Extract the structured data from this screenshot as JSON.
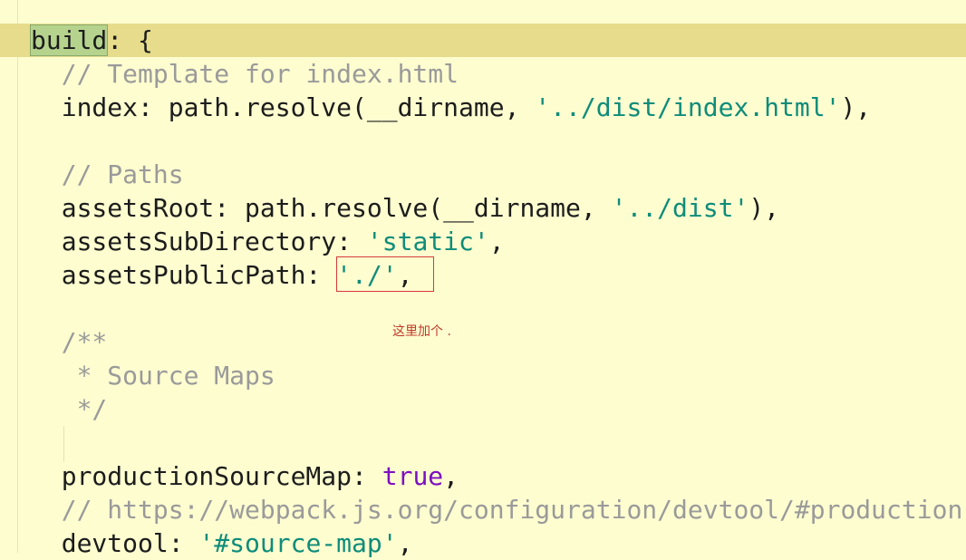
{
  "editor": {
    "lines": [
      {
        "parts": [
          {
            "t": "build",
            "c": "sel"
          },
          {
            "t": ": {",
            "c": "plain"
          }
        ]
      },
      {
        "parts": [
          {
            "t": "  // Template for index.html",
            "c": "cm"
          }
        ]
      },
      {
        "parts": [
          {
            "t": "  index: path.resolve(__dirname, ",
            "c": "plain"
          },
          {
            "t": "'../dist/index.html'",
            "c": "str"
          },
          {
            "t": "),",
            "c": "plain"
          }
        ]
      },
      {
        "parts": []
      },
      {
        "parts": [
          {
            "t": "  // Paths",
            "c": "cm"
          }
        ]
      },
      {
        "parts": [
          {
            "t": "  assetsRoot: path.resolve(__dirname, ",
            "c": "plain"
          },
          {
            "t": "'../dist'",
            "c": "str"
          },
          {
            "t": "),",
            "c": "plain"
          }
        ]
      },
      {
        "parts": [
          {
            "t": "  assetsSubDirectory: ",
            "c": "plain"
          },
          {
            "t": "'static'",
            "c": "str"
          },
          {
            "t": ",",
            "c": "plain"
          }
        ]
      },
      {
        "parts": [
          {
            "t": "  assetsPublicPath: ",
            "c": "plain"
          },
          {
            "t": "'./'",
            "c": "str"
          },
          {
            "t": ",",
            "c": "plain"
          }
        ]
      },
      {
        "parts": []
      },
      {
        "parts": [
          {
            "t": "  /**",
            "c": "cm"
          }
        ]
      },
      {
        "parts": [
          {
            "t": "   * Source Maps",
            "c": "cm"
          }
        ]
      },
      {
        "parts": [
          {
            "t": "   */",
            "c": "cm"
          }
        ]
      },
      {
        "parts": []
      },
      {
        "parts": [
          {
            "t": "  productionSourceMap: ",
            "c": "plain"
          },
          {
            "t": "true",
            "c": "kw"
          },
          {
            "t": ",",
            "c": "plain"
          }
        ]
      },
      {
        "parts": [
          {
            "t": "  // https://webpack.js.org/configuration/devtool/#production",
            "c": "cm"
          }
        ]
      },
      {
        "parts": [
          {
            "t": "  devtool: ",
            "c": "plain"
          },
          {
            "t": "'#source-map'",
            "c": "str"
          },
          {
            "t": ",",
            "c": "plain"
          }
        ]
      }
    ],
    "current_line_index": 0
  },
  "annotation": {
    "note": "这里加个 ."
  }
}
